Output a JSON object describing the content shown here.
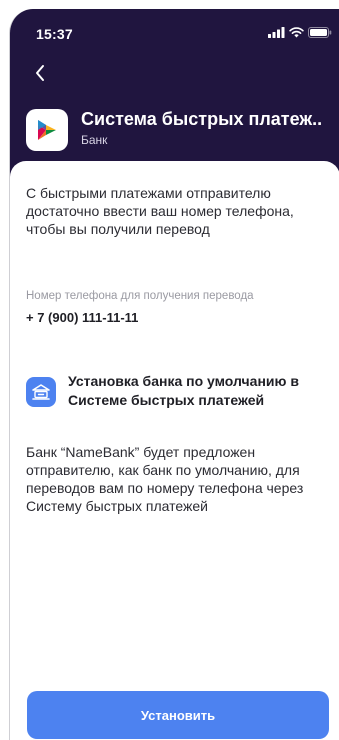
{
  "status_bar": {
    "time": "15:37",
    "icons": [
      "signal-icon",
      "wifi-icon",
      "battery-icon"
    ]
  },
  "header": {
    "back_icon": "chevron-left-icon",
    "app_title": "Система быстрых платеж..",
    "app_subtitle": "Банк",
    "logo_icon": "sbp-logo-icon"
  },
  "content": {
    "intro": "С быстрыми платежами отправителю достаточно ввести ваш номер телефона, чтобы вы получили перевод",
    "phone_label": "Номер телефона для получения перевода",
    "phone_value": "+ 7 (900) 111-11-11",
    "bank_default_title": "Установка банка по умолчанию в Системе быстрых платежей",
    "bank_icon": "bank-icon",
    "description": "Банк “NameBank” будет предложен отправителю, как банк по умолчанию, для переводов вам по номеру телефона через Систему быстрых платежей"
  },
  "actions": {
    "install_label": "Установить"
  },
  "colors": {
    "header_bg": "#20153f",
    "accent": "#4d82f0"
  }
}
